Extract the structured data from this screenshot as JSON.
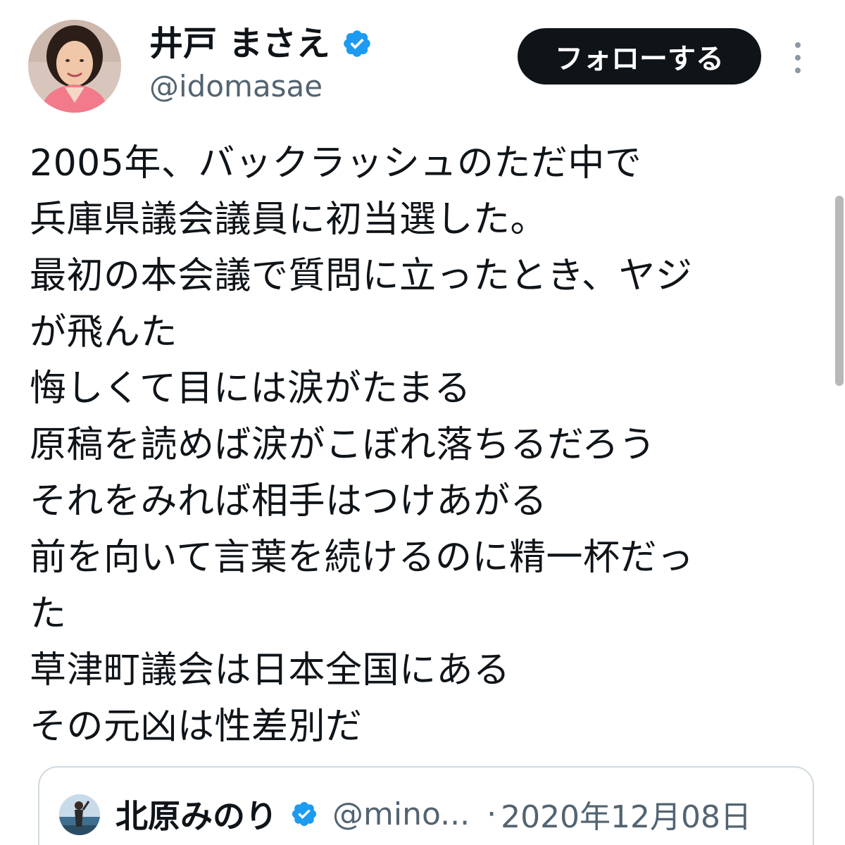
{
  "author": {
    "display_name": "井戸 まさえ",
    "handle": "@idomasae",
    "verified": true,
    "avatar_icon": "profile-photo"
  },
  "follow_button": {
    "label": "フォローする"
  },
  "more_menu": {
    "icon": "vertical-dots-icon"
  },
  "tweet": {
    "lines": [
      "2005年、バックラッシュのただ中で",
      "兵庫県議会議員に初当選した。",
      "最初の本会議で質問に立ったとき、ヤジ",
      "が飛んた",
      "悔しくて目には涙がたまる",
      "原稿を読めば涙がこぼれ落ちるだろう",
      "それをみれば相手はつけあがる",
      "前を向いて言葉を続けるのに精一杯だっ",
      "た",
      "草津町議会は日本全国にある",
      "その元凶は性差別だ"
    ]
  },
  "quoted_tweet": {
    "display_name": "北原みのり",
    "verified": true,
    "handle": "@mino...",
    "separator": "·",
    "date": "2020年12月08日",
    "avatar_icon": "profile-photo"
  },
  "colors": {
    "text": "#0f1419",
    "secondary": "#536471",
    "verified_blue": "#1d9bf0",
    "button_bg": "#0f1419",
    "border": "#cfd9de"
  }
}
